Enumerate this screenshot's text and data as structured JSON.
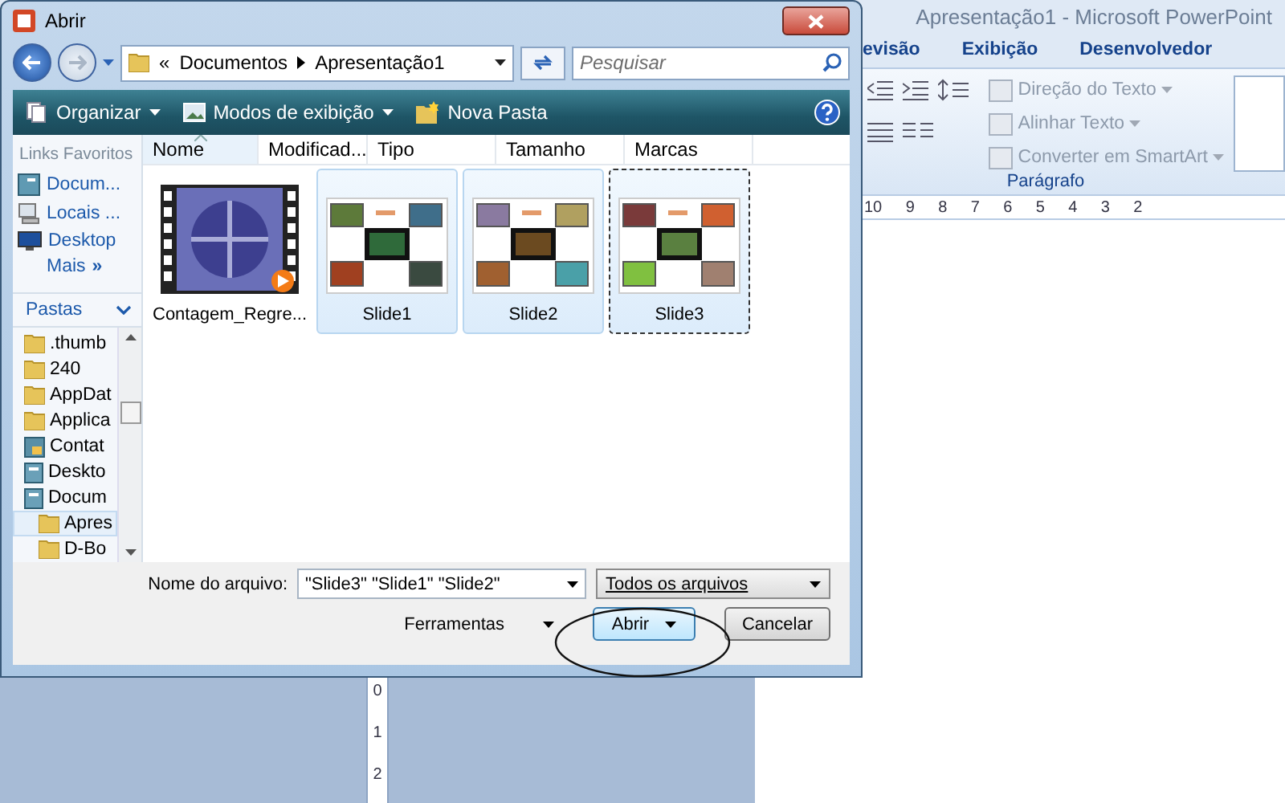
{
  "powerpoint": {
    "title": "Apresentação1  -  Microsoft PowerPoint",
    "tabs": [
      "evisão",
      "Exibição",
      "Desenvolvedor"
    ],
    "paragraph_group": {
      "label": "Parágrafo",
      "commands": [
        {
          "label": "Direção do Texto",
          "disabled": true
        },
        {
          "label": "Alinhar Texto",
          "disabled": true
        },
        {
          "label": "Converter em SmartArt",
          "disabled": true
        }
      ]
    },
    "ruler": {
      "horizontal": [
        "10",
        "9",
        "8",
        "7",
        "6",
        "5",
        "4",
        "3",
        "2"
      ],
      "vertical": [
        "0",
        "1",
        "2"
      ]
    }
  },
  "dialog": {
    "title": "Abrir",
    "breadcrumb": {
      "overflow": "«",
      "items": [
        "Documentos",
        "Apresentação1"
      ]
    },
    "search": {
      "placeholder": "Pesquisar"
    },
    "toolbar": [
      "Organizar",
      "Modos de exibição",
      "Nova Pasta"
    ],
    "favorites": {
      "title": "Links Favoritos",
      "items": [
        {
          "label": "Docum...",
          "kind": "documents"
        },
        {
          "label": "Locais ...",
          "kind": "places"
        },
        {
          "label": "Desktop",
          "kind": "desktop"
        }
      ],
      "more": {
        "label": "Mais",
        "glyph": "»"
      }
    },
    "folders": {
      "title": "Pastas",
      "tree": [
        {
          "label": ".thumb",
          "kind": "folder",
          "selected": false
        },
        {
          "label": "240",
          "kind": "folder",
          "selected": false
        },
        {
          "label": "AppDat",
          "kind": "folder",
          "selected": false
        },
        {
          "label": "Applica",
          "kind": "folder",
          "selected": false
        },
        {
          "label": "Contat",
          "kind": "contacts",
          "selected": false
        },
        {
          "label": "Deskto",
          "kind": "library",
          "selected": false
        },
        {
          "label": "Docum",
          "kind": "library",
          "selected": false,
          "children": [
            {
              "label": "Apres",
              "kind": "folder",
              "selected": true
            },
            {
              "label": "D-Bo",
              "kind": "folder",
              "selected": false
            }
          ]
        }
      ]
    },
    "columns": [
      {
        "label": "Nome",
        "sorted": true
      },
      {
        "label": "Modificad...",
        "sorted": false
      },
      {
        "label": "Tipo",
        "sorted": false
      },
      {
        "label": "Tamanho",
        "sorted": false
      },
      {
        "label": "Marcas",
        "sorted": false
      }
    ],
    "files": [
      {
        "name": "Contagem_Regre...",
        "kind": "video",
        "selected": false,
        "focused": false
      },
      {
        "name": "Slide1",
        "kind": "slide",
        "selected": true,
        "focused": false
      },
      {
        "name": "Slide2",
        "kind": "slide",
        "selected": true,
        "focused": false
      },
      {
        "name": "Slide3",
        "kind": "slide",
        "selected": true,
        "focused": true
      }
    ],
    "file_name": {
      "label": "Nome do arquivo:",
      "value": "\"Slide3\" \"Slide1\" \"Slide2\""
    },
    "file_type": {
      "value": "Todos os arquivos"
    },
    "tools": "Ferramentas",
    "buttons": {
      "open": "Abrir",
      "cancel": "Cancelar"
    }
  }
}
